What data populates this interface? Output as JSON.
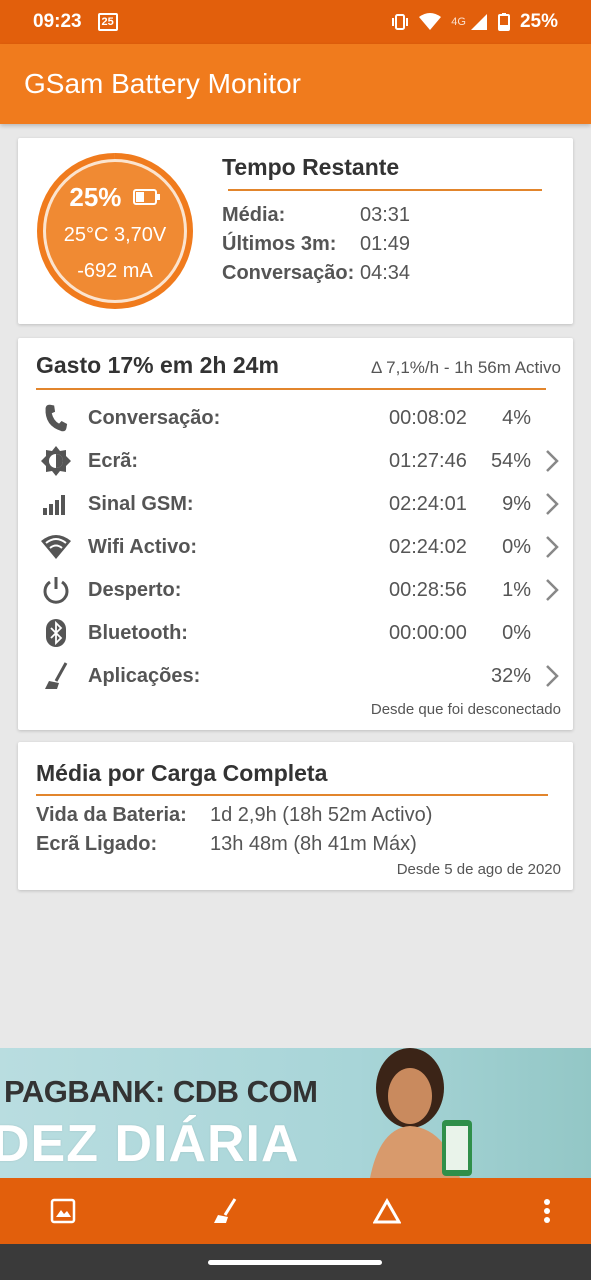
{
  "status_bar": {
    "time": "09:23",
    "calendar_day": "25",
    "network": "4G",
    "battery_text": "25%",
    "color": "#e25f0c"
  },
  "app": {
    "title": "GSam Battery Monitor",
    "accent": "#f07b1d"
  },
  "battery": {
    "percent_label": "25%",
    "level": 0.25,
    "temp_volt": "25°C  3,70V",
    "current": "-692 mA"
  },
  "time_remaining": {
    "title": "Tempo Restante",
    "rows": [
      {
        "label": "Média:",
        "value": "03:31"
      },
      {
        "label": "Últimos 3m:",
        "value": "01:49"
      },
      {
        "label": "Conversação:",
        "value": "04:34"
      }
    ]
  },
  "usage": {
    "title": "Gasto 17% em 2h 24m",
    "delta": "Δ 7,1%/h - 1h 56m Activo",
    "since": "Desde que foi desconectado",
    "rows": [
      {
        "icon": "phone-icon",
        "label": "Conversação:",
        "time": "00:08:02",
        "pct": "4%",
        "chevron": false
      },
      {
        "icon": "brightness-icon",
        "label": "Ecrã:",
        "time": "01:27:46",
        "pct": "54%",
        "chevron": true
      },
      {
        "icon": "signal-bars-icon",
        "label": "Sinal GSM:",
        "time": "02:24:01",
        "pct": "9%",
        "chevron": true
      },
      {
        "icon": "wifi-icon",
        "label": "Wifi Activo:",
        "time": "02:24:02",
        "pct": "0%",
        "chevron": true
      },
      {
        "icon": "power-icon",
        "label": "Desperto:",
        "time": "00:28:56",
        "pct": "1%",
        "chevron": true
      },
      {
        "icon": "bluetooth-icon",
        "label": "Bluetooth:",
        "time": "00:00:00",
        "pct": "0%",
        "chevron": false
      },
      {
        "icon": "broom-icon",
        "label": "Aplicações:",
        "time": "",
        "pct": "32%",
        "chevron": true
      }
    ]
  },
  "full_charge": {
    "title": "Média por Carga Completa",
    "battery_life_label": "Vida da Bateria:",
    "battery_life_value": "1d 2,9h (18h 52m Activo)",
    "screen_on_label": "Ecrã Ligado:",
    "screen_on_value": "13h 48m (8h 41m Máx)",
    "since": "Desde 5 de ago de 2020"
  },
  "ad": {
    "line1": "PAGBANK: CDB COM",
    "line2": "DEZ DIÁRIA"
  },
  "bottom_bar": {
    "buttons": [
      "image-icon",
      "broom-icon",
      "triangle-icon",
      "more-vert-icon"
    ]
  }
}
